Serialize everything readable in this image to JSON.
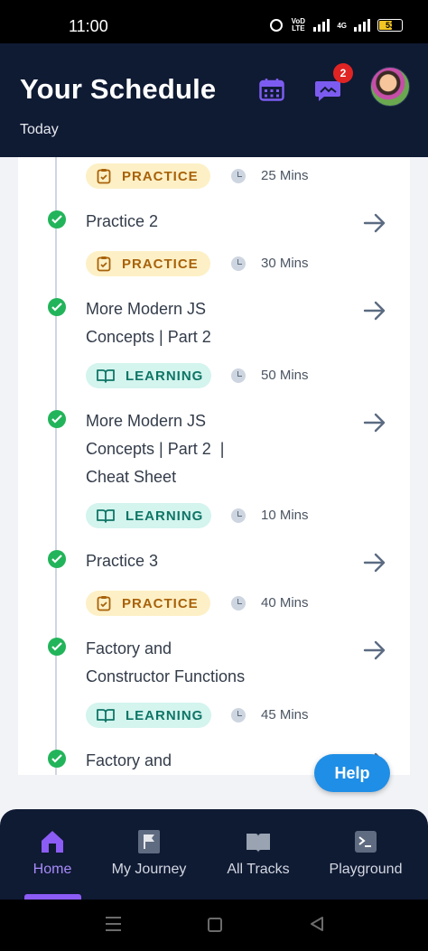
{
  "status_bar": {
    "time": "11:00",
    "volte": "VoD LTE",
    "network": "4G",
    "battery": "53"
  },
  "header": {
    "title": "Your Schedule",
    "subtitle": "Today",
    "notification_count": "2"
  },
  "items": [
    {
      "title_lines": [],
      "tag": "PRACTICE",
      "duration": "25 Mins"
    },
    {
      "title_lines": [
        "Practice 2"
      ],
      "tag": "PRACTICE",
      "duration": "30 Mins"
    },
    {
      "title_lines": [
        "More Modern JS",
        "Concepts | Part 2"
      ],
      "tag": "LEARNING",
      "duration": "50 Mins"
    },
    {
      "title_lines": [
        "More Modern JS",
        "Concepts | Part 2  |",
        "Cheat Sheet"
      ],
      "tag": "LEARNING",
      "duration": "10 Mins"
    },
    {
      "title_lines": [
        "Practice 3"
      ],
      "tag": "PRACTICE",
      "duration": "40 Mins"
    },
    {
      "title_lines": [
        "Factory and",
        "Constructor Functions"
      ],
      "tag": "LEARNING",
      "duration": "45 Mins"
    },
    {
      "title_lines": [
        "Factory and"
      ],
      "tag": "",
      "duration": ""
    }
  ],
  "help_label": "Help",
  "bottom_nav": [
    {
      "label": "Home",
      "icon": "home-icon",
      "active": true
    },
    {
      "label": "My Journey",
      "icon": "flag-icon",
      "active": false
    },
    {
      "label": "All Tracks",
      "icon": "book-icon",
      "active": false
    },
    {
      "label": "Playground",
      "icon": "terminal-icon",
      "active": false
    }
  ],
  "colors": {
    "header_bg": "#0f1a33",
    "accent_purple": "#8b5cf6",
    "check_green": "#22b45a",
    "practice_bg": "#fdf0c6",
    "practice_text": "#a8620a",
    "learning_bg": "#d4f4ee",
    "learning_text": "#0e7566",
    "help_blue": "#1f8ee6"
  }
}
